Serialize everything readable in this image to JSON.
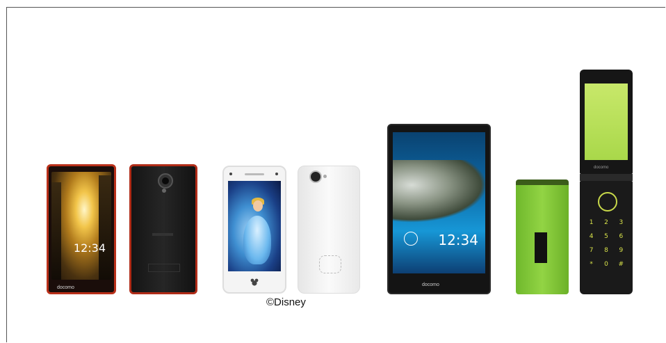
{
  "caption": "©Disney",
  "devices": {
    "phone1_front": {
      "clock": "12:34",
      "brand": "docomo"
    },
    "tablet": {
      "clock": "12:34",
      "brand": "docomo"
    },
    "flip_open": {
      "brand": "docomo",
      "keys": [
        "1",
        "2",
        "3",
        "4",
        "5",
        "6",
        "7",
        "8",
        "9",
        "*",
        "0",
        "#"
      ]
    }
  }
}
